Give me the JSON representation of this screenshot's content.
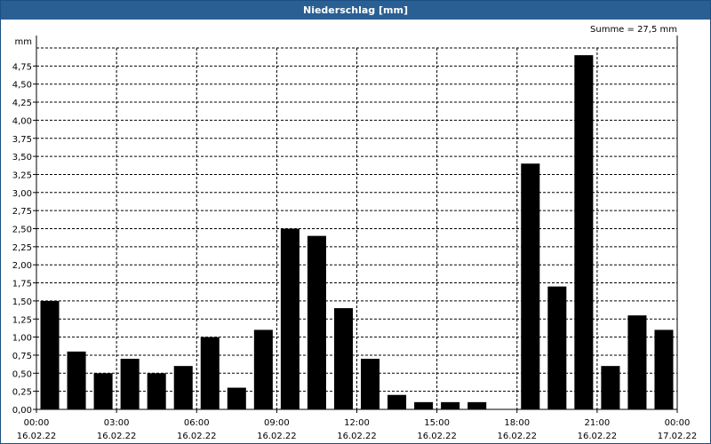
{
  "window": {
    "title": "Niederschlag [mm]"
  },
  "chart_data": {
    "type": "bar",
    "title": "Niederschlag [mm]",
    "ylabel": "mm",
    "summary": "Summe = 27,5 mm",
    "ylim": [
      0,
      5.0
    ],
    "yticks": [
      "0,00",
      "0,25",
      "0,50",
      "0,75",
      "1,00",
      "1,25",
      "1,50",
      "1,75",
      "2,00",
      "2,25",
      "2,50",
      "2,75",
      "3,00",
      "3,25",
      "3,50",
      "3,75",
      "4,00",
      "4,25",
      "4,50",
      "4,75"
    ],
    "xticks": [
      {
        "time": "00:00",
        "date": "16.02.22"
      },
      {
        "time": "03:00",
        "date": "16.02.22"
      },
      {
        "time": "06:00",
        "date": "16.02.22"
      },
      {
        "time": "09:00",
        "date": "16.02.22"
      },
      {
        "time": "12:00",
        "date": "16.02.22"
      },
      {
        "time": "15:00",
        "date": "16.02.22"
      },
      {
        "time": "18:00",
        "date": "16.02.22"
      },
      {
        "time": "21:00",
        "date": "16.02.22"
      },
      {
        "time": "00:00",
        "date": "17.02.22"
      }
    ],
    "categories": [
      "00:00",
      "01:00",
      "02:00",
      "03:00",
      "04:00",
      "05:00",
      "06:00",
      "07:00",
      "08:00",
      "09:00",
      "10:00",
      "11:00",
      "12:00",
      "13:00",
      "14:00",
      "15:00",
      "16:00",
      "17:00",
      "18:00",
      "19:00",
      "20:00",
      "21:00",
      "22:00",
      "23:00"
    ],
    "values": [
      1.5,
      0.8,
      0.5,
      0.7,
      0.5,
      0.6,
      1.0,
      0.3,
      1.1,
      2.5,
      2.4,
      1.4,
      0.7,
      0.2,
      0.1,
      0.1,
      0.1,
      0.0,
      3.4,
      1.7,
      4.9,
      0.6,
      1.3,
      1.1
    ],
    "grid": true,
    "bar_color": "#000000"
  }
}
